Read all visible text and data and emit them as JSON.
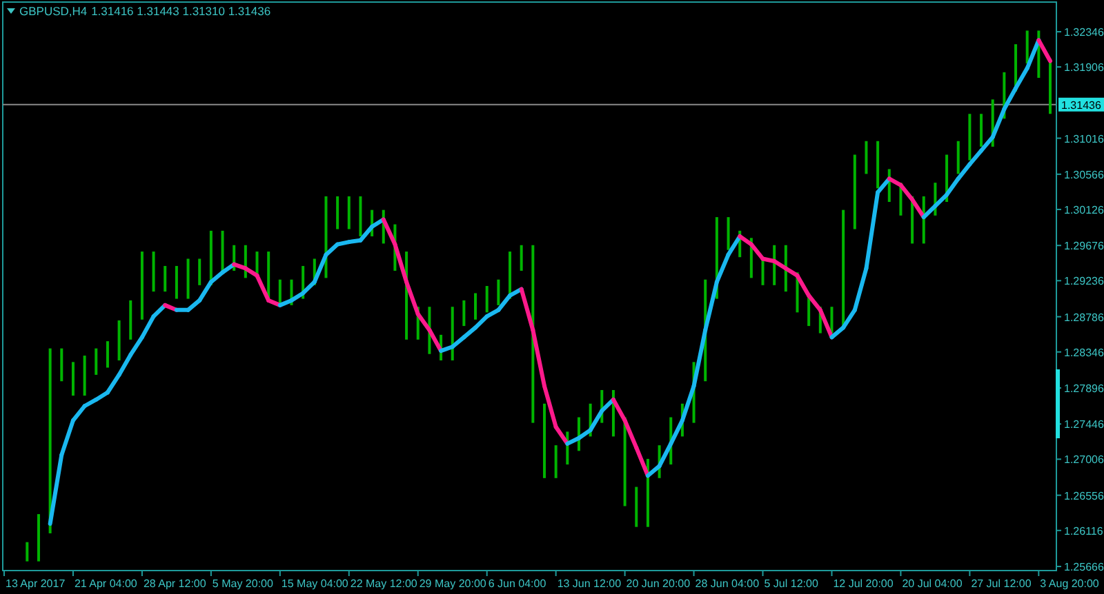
{
  "chart_header": {
    "symbol": "GBPUSD,H4",
    "ohlc": "1.31416 1.31443 1.31310 1.31436"
  },
  "current_price_label": "1.31436",
  "price_axis_labels": [
    "1.32346",
    "1.31906",
    "1.31016",
    "1.30566",
    "1.30126",
    "1.29676",
    "1.29236",
    "1.28786",
    "1.28346",
    "1.27896",
    "1.27446",
    "1.27006",
    "1.26556",
    "1.26116",
    "1.25666"
  ],
  "time_axis_labels": [
    "13 Apr 2017",
    "21 Apr 04:00",
    "28 Apr 12:00",
    "5 May 20:00",
    "15 May 04:00",
    "22 May 12:00",
    "29 May 20:00",
    "6 Jun 04:00",
    "13 Jun 12:00",
    "20 Jun 20:00",
    "28 Jun 04:00",
    "5 Jul 12:00",
    "12 Jul 20:00",
    "20 Jul 04:00",
    "27 Jul 12:00",
    "3 Aug 20:00"
  ]
}
